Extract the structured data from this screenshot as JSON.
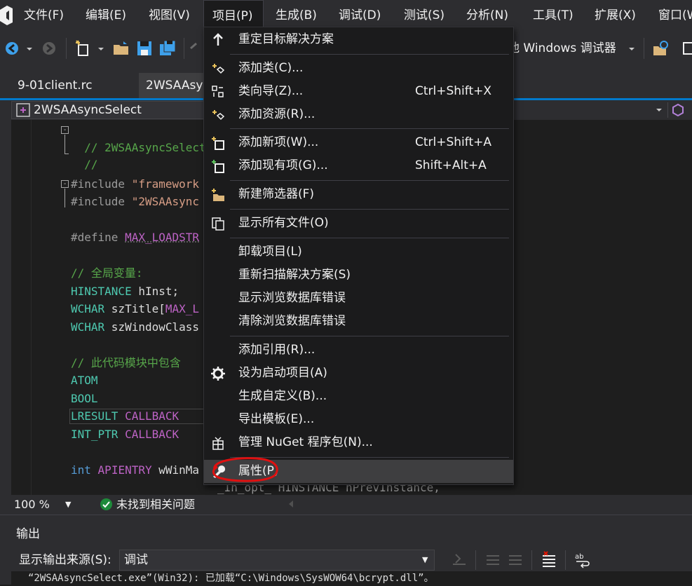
{
  "menubar": {
    "items": [
      "文件(F)",
      "编辑(E)",
      "视图(V)",
      "项目(P)",
      "生成(B)",
      "调试(D)",
      "测试(S)",
      "分析(N)",
      "工具(T)",
      "扩展(X)",
      "窗口(W"
    ],
    "active": "项目(P)"
  },
  "toolbar": {
    "debugger_label": "他 Windows 调试器"
  },
  "tabs": [
    {
      "label": "9-01client.rc",
      "active": false
    },
    {
      "label": "2WSAAsy",
      "active": true
    }
  ],
  "navbar": {
    "scope": "2WSAAsyncSelect"
  },
  "editor": {
    "lines": [
      {
        "segments": [
          {
            "t": "// 2WSAAsyncSelect.",
            "c": "comment"
          }
        ]
      },
      {
        "segments": [
          {
            "t": "//",
            "c": "comment"
          }
        ]
      },
      {
        "segments": [
          {
            "t": "#include ",
            "c": "pre"
          },
          {
            "t": "\"framework",
            "c": "str"
          }
        ]
      },
      {
        "segments": [
          {
            "t": "#include ",
            "c": "pre"
          },
          {
            "t": "\"2WSAAsync",
            "c": "str"
          }
        ]
      },
      {
        "segments": [
          {
            "t": "#define ",
            "c": "pre"
          },
          {
            "t": "MAX_LOADSTR",
            "c": "macro"
          }
        ]
      },
      {
        "segments": [
          {
            "t": "// 全局变量:",
            "c": "comment"
          }
        ]
      },
      {
        "segments": [
          {
            "t": "HINSTANCE",
            "c": "type"
          },
          {
            "t": " hInst;",
            "c": "plain"
          }
        ]
      },
      {
        "segments": [
          {
            "t": "WCHAR",
            "c": "type"
          },
          {
            "t": " szTitle[",
            "c": "plain"
          },
          {
            "t": "MAX_L",
            "c": "macro"
          }
        ]
      },
      {
        "segments": [
          {
            "t": "WCHAR",
            "c": "type"
          },
          {
            "t": " szWindowClass",
            "c": "plain"
          }
        ]
      },
      {
        "segments": [
          {
            "t": "// 此代码模块中包含",
            "c": "comment"
          }
        ]
      },
      {
        "segments": [
          {
            "t": "ATOM",
            "c": "type"
          }
        ]
      },
      {
        "segments": [
          {
            "t": "BOOL",
            "c": "type"
          }
        ]
      },
      {
        "segments": [
          {
            "t": "LRESULT",
            "c": "type"
          },
          {
            "t": " ",
            "c": "plain"
          },
          {
            "t": "CALLBACK",
            "c": "macro"
          }
        ]
      },
      {
        "segments": [
          {
            "t": "INT_PTR",
            "c": "type"
          },
          {
            "t": " ",
            "c": "plain"
          },
          {
            "t": "CALLBACK",
            "c": "macro"
          }
        ]
      },
      {
        "segments": [
          {
            "t": "int",
            "c": "kw"
          },
          {
            "t": " ",
            "c": "plain"
          },
          {
            "t": "APIENTRY",
            "c": "macro"
          },
          {
            "t": " wWinMa",
            "c": "plain"
          }
        ]
      },
      {
        "segments": [
          {
            "t": "_In_opt_ HINSTANCE hPrevInstance,",
            "c": "pre"
          }
        ]
      }
    ]
  },
  "dropdown": {
    "items": [
      {
        "label": "重定目标解决方案",
        "shortcut": "",
        "icon": "arrow-up-icon"
      },
      {
        "label": "添加类(C)...",
        "shortcut": "",
        "icon": "add-class-icon"
      },
      {
        "label": "类向导(Z)...",
        "shortcut": "Ctrl+Shift+X",
        "icon": "class-wizard-icon"
      },
      {
        "label": "添加资源(R)...",
        "shortcut": "",
        "icon": "add-resource-icon"
      },
      {
        "label": "添加新项(W)...",
        "shortcut": "Ctrl+Shift+A",
        "icon": "add-new-item-icon"
      },
      {
        "label": "添加现有项(G)...",
        "shortcut": "Shift+Alt+A",
        "icon": "add-existing-item-icon"
      },
      {
        "label": "新建筛选器(F)",
        "shortcut": "",
        "icon": "new-filter-icon"
      },
      {
        "label": "显示所有文件(O)",
        "shortcut": "",
        "icon": "show-all-files-icon"
      },
      {
        "label": "卸载项目(L)",
        "shortcut": "",
        "icon": ""
      },
      {
        "label": "重新扫描解决方案(S)",
        "shortcut": "",
        "icon": ""
      },
      {
        "label": "显示浏览数据库错误",
        "shortcut": "",
        "icon": ""
      },
      {
        "label": "清除浏览数据库错误",
        "shortcut": "",
        "icon": ""
      },
      {
        "label": "添加引用(R)...",
        "shortcut": "",
        "icon": ""
      },
      {
        "label": "设为启动项目(A)",
        "shortcut": "",
        "icon": "gear-icon"
      },
      {
        "label": "生成自定义(B)...",
        "shortcut": "",
        "icon": ""
      },
      {
        "label": "导出模板(E)...",
        "shortcut": "",
        "icon": ""
      },
      {
        "label": "管理 NuGet 程序包(N)...",
        "shortcut": "",
        "icon": "nuget-icon"
      },
      {
        "label": "属性(P)",
        "shortcut": "",
        "icon": "wrench-icon",
        "highlighted": true
      }
    ]
  },
  "status": {
    "zoom": "100 %",
    "issues": "未找到相关问题"
  },
  "output": {
    "title": "输出",
    "source_label": "显示输出来源(S):",
    "source_value": "调试",
    "line": "“2WSAAsyncSelect.exe”(Win32): 已加载“C:\\Windows\\SysWOW64\\bcrypt.dll”。"
  },
  "colors": {
    "accent": "#007acc",
    "annotation": "#e01010",
    "menu_bg": "#1b1b1c",
    "highlight": "#3e3e40"
  }
}
